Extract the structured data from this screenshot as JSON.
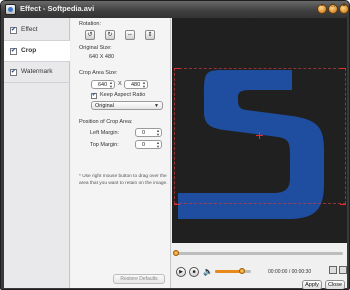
{
  "window": {
    "title": "Effect - Softpedia.avi"
  },
  "sidebar": {
    "items": [
      {
        "label": "Effect",
        "checked": true,
        "active": false
      },
      {
        "label": "Crop",
        "checked": true,
        "active": true
      },
      {
        "label": "Watermark",
        "checked": true,
        "active": false
      }
    ]
  },
  "crop": {
    "rotation_label": "Rotation:",
    "original_size_label": "Original Size:",
    "original_size_value": "640 X 480",
    "crop_area_size_label": "Crop Area Size:",
    "width": "640",
    "x_label": "X",
    "height": "480",
    "keep_aspect_label": "Keep Aspect Ratio",
    "aspect_select": "Original",
    "position_label": "Position of Crop Area:",
    "left_margin_label": "Left Margin:",
    "left_margin": "0",
    "top_margin_label": "Top Margin:",
    "top_margin": "0",
    "note": "* Use right mouse button to drag over the area that you want to retain on the image.",
    "restore_defaults": "Restore Defaults"
  },
  "player": {
    "time": "00:00:00 / 00:00:30",
    "seek_progress": 0.0,
    "volume": 0.75
  },
  "buttons": {
    "apply": "Apply",
    "close": "Close"
  },
  "colors": {
    "letter": "#1f4ea0",
    "accent": "#e88a1a"
  }
}
